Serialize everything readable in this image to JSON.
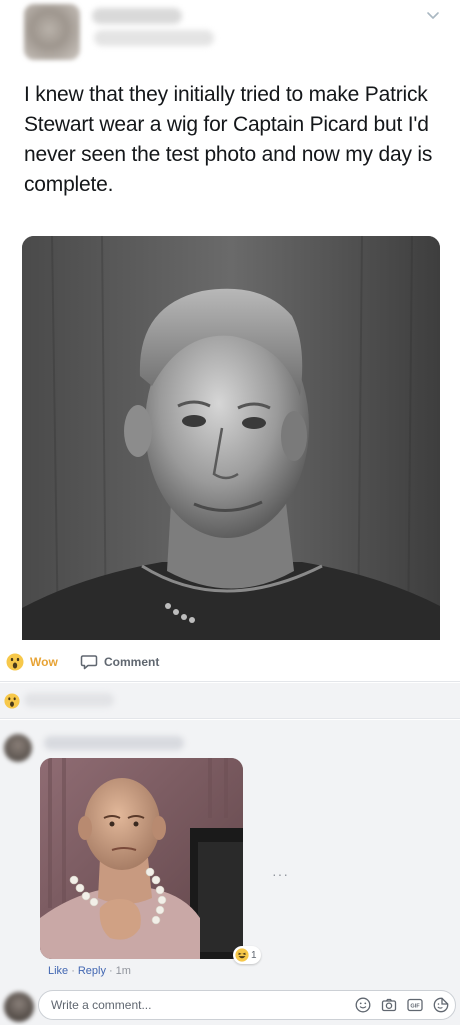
{
  "tweet": {
    "text": "I knew that they initially tried to make Patrick Stewart wear a wig for Captain Picard but I'd never seen the test photo and now my day is complete."
  },
  "facebook": {
    "actions": {
      "wow_label": "Wow",
      "comment_label": "Comment"
    },
    "comment": {
      "reaction_count": "1",
      "like_label": "Like",
      "reply_label": "Reply",
      "separator": "·",
      "time": "1m",
      "more_label": "···"
    },
    "composer": {
      "placeholder": "Write a comment..."
    }
  },
  "icons": {
    "wow": "wow-emoji-icon",
    "comment": "speech-bubble-icon",
    "chevron": "chevron-down-icon",
    "emoji": "smiley-icon",
    "camera": "camera-icon",
    "gif": "gif-icon",
    "sticker": "sticker-icon"
  },
  "colors": {
    "wow_accent": "#e7a335",
    "link_blue": "#4267b2",
    "muted_text": "#90949c",
    "tweet_text": "#14171a"
  }
}
